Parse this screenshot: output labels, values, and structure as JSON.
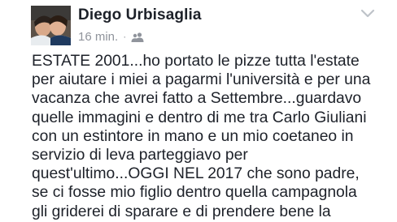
{
  "post": {
    "author": "Diego Urbisaglia",
    "timestamp": "16 min.",
    "separator": "·",
    "privacy_icon": "friends-icon",
    "options_icon": "chevron-down-icon",
    "avatar_icon": "profile-photo",
    "body_lines": [
      "ESTATE 2001...ho portato le pizze tutta l'estate",
      "per aiutare i miei a pagarmi l'università e per una",
      "vacanza che avrei fatto a Settembre...guardavo",
      "quelle immagini e dentro di me tra Carlo Giuliani",
      "con un estintore in mano e un mio coetaneo in",
      "servizio di leva parteggiavo per",
      "quest'ultimo...OGGI NEL 2017 che sono padre,",
      "se ci fosse mio figlio dentro quella campagnola",
      "gli griderei di sparare e di prendere bene la"
    ]
  },
  "colors": {
    "text": "#1d2129",
    "meta": "#90949c",
    "background": "#ffffff"
  }
}
